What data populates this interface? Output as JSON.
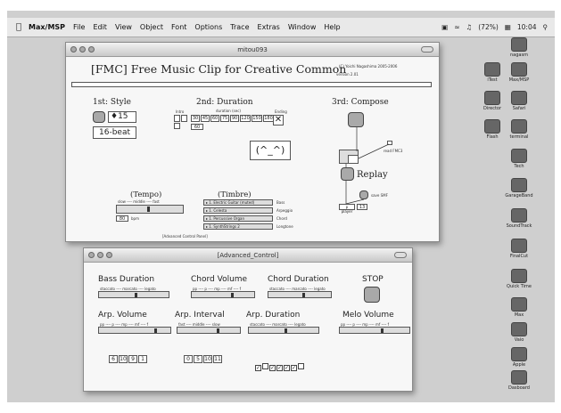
{
  "menubar": {
    "apple": "",
    "app": "Max/MSP",
    "items": [
      "File",
      "Edit",
      "View",
      "Object",
      "Font",
      "Options",
      "Trace",
      "Extras",
      "Window",
      "Help"
    ],
    "status": {
      "battery": "(72%)",
      "clock": "10:04"
    }
  },
  "desktop_icons": [
    "nagasm",
    "iTest",
    "Max/MSP",
    "Director",
    "Safari",
    "Flash",
    "terminal",
    "Tech",
    "GarageBand",
    "SoundTrack",
    "FinalCut",
    "Quick Time",
    "Max",
    "Vaio",
    "Apple",
    "Dasboard"
  ],
  "main_window": {
    "title": "mitou093",
    "header_title": "[FMC] Free Music Clip for Creative Common",
    "header_version": "version 2.01",
    "copyright": "(C) Yoichi Nagashima 2005-2006",
    "sections": {
      "style": "1st: Style",
      "duration": "2nd: Duration",
      "compose": "3rd: Compose",
      "tempo": "(Tempo)",
      "timbre": "(Timbre)",
      "replay": "Replay"
    },
    "style_value": "15",
    "style_beat": "16-beat",
    "duration_labels": {
      "intro": "Intro",
      "duration": "duration (sec)",
      "ending": "Ending"
    },
    "duration_values": [
      "30",
      "45",
      "60",
      "75",
      "90",
      "120",
      "150",
      "180"
    ],
    "duration_count": "60",
    "face": "(^_^)",
    "tempo_scale": "slow ---- middle ---- fast",
    "tempo_value": "80",
    "tempo_unit": "bpm",
    "timbre_rows": [
      {
        "menu": "1. Electric Guitar (muted)",
        "part": "Bass"
      },
      {
        "menu": "1. Celesta",
        "part": "Arpeggio"
      },
      {
        "menu": "1. Percussive Organ",
        "part": "Chord"
      },
      {
        "menu": "1. SynthStrings 2",
        "part": "Longtone"
      }
    ],
    "read_label": "read FMC3",
    "save_label": "save SMF",
    "player_label": "p player",
    "player_value": "13",
    "advanced_link": "[Advanced Control Panel]"
  },
  "advanced_window": {
    "title": "[Advanced_Control]",
    "labels": {
      "bass_duration": "Bass Duration",
      "chord_volume": "Chord Volume",
      "chord_duration": "Chord Duration",
      "stop": "STOP",
      "arp_volume": "Arp. Volume",
      "arp_interval": "Arp. Interval",
      "arp_duration": "Arp. Duration",
      "melo_volume": "Melo Volume"
    },
    "scales": {
      "staccato": "staccato ---- marcato ---- legato",
      "volume": "pp ---- p ---- mp ---- mf ---- f",
      "interval": "fast ---- middle ---- slow"
    },
    "numbers_a": [
      "6",
      "10",
      "9",
      "1"
    ],
    "numbers_b": [
      "0",
      "5",
      "10",
      "11"
    ],
    "checkboxes": [
      "✓",
      "",
      "✓",
      "✓",
      "✓",
      "✓",
      ""
    ]
  }
}
